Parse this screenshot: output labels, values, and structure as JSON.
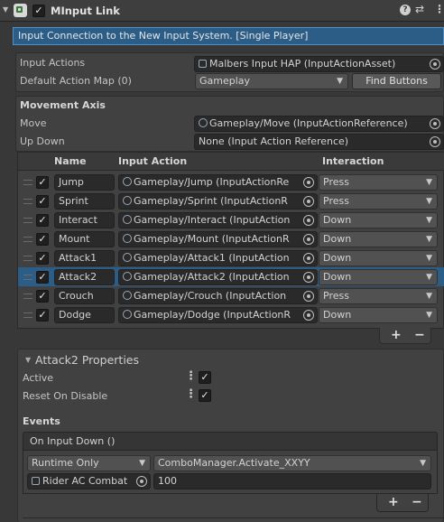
{
  "header": {
    "title": "MInput Link",
    "enabled": true,
    "info_text": "Input Connection to the New Input System. [Single Player]"
  },
  "general": {
    "input_actions_label": "Input Actions",
    "input_actions_value": "Malbers Input HAP (InputActionAsset)",
    "action_map_label": "Default Action Map (0)",
    "action_map_value": "Gameplay",
    "find_buttons_label": "Find Buttons"
  },
  "movement": {
    "title": "Movement Axis",
    "move_label": "Move",
    "move_value": "Gameplay/Move (InputActionReference)",
    "updown_label": "Up Down",
    "updown_value": "None (Input Action Reference)"
  },
  "buttons_table": {
    "headers": {
      "name": "Name",
      "input_action": "Input Action",
      "interaction": "Interaction"
    },
    "rows": [
      {
        "name": "Jump",
        "action": "Gameplay/Jump (InputActionRe",
        "interaction": "Press",
        "enabled": true,
        "selected": false
      },
      {
        "name": "Sprint",
        "action": "Gameplay/Sprint (InputActionR",
        "interaction": "Press",
        "enabled": true,
        "selected": false
      },
      {
        "name": "Interact",
        "action": "Gameplay/Interact (InputAction",
        "interaction": "Down",
        "enabled": true,
        "selected": false
      },
      {
        "name": "Mount",
        "action": "Gameplay/Mount (InputActionR",
        "interaction": "Down",
        "enabled": true,
        "selected": false
      },
      {
        "name": "Attack1",
        "action": "Gameplay/Attack1 (InputAction",
        "interaction": "Down",
        "enabled": true,
        "selected": false
      },
      {
        "name": "Attack2",
        "action": "Gameplay/Attack2 (InputAction",
        "interaction": "Down",
        "enabled": true,
        "selected": true
      },
      {
        "name": "Crouch",
        "action": "Gameplay/Crouch (InputAction",
        "interaction": "Press",
        "enabled": true,
        "selected": false
      },
      {
        "name": "Dodge",
        "action": "Gameplay/Dodge (InputActionR",
        "interaction": "Down",
        "enabled": true,
        "selected": false
      }
    ],
    "add_label": "+",
    "remove_label": "−"
  },
  "properties": {
    "title": "Attack2 Properties",
    "active_label": "Active",
    "active": true,
    "reset_label": "Reset On Disable",
    "reset": true,
    "events_title": "Events",
    "event_name": "On Input Down ()",
    "runtime_value": "Runtime Only",
    "function_value": "ComboManager.Activate_XXYY",
    "object_value": "Rider AC Combat",
    "argument_value": "100",
    "add_label": "+",
    "remove_label": "−"
  }
}
